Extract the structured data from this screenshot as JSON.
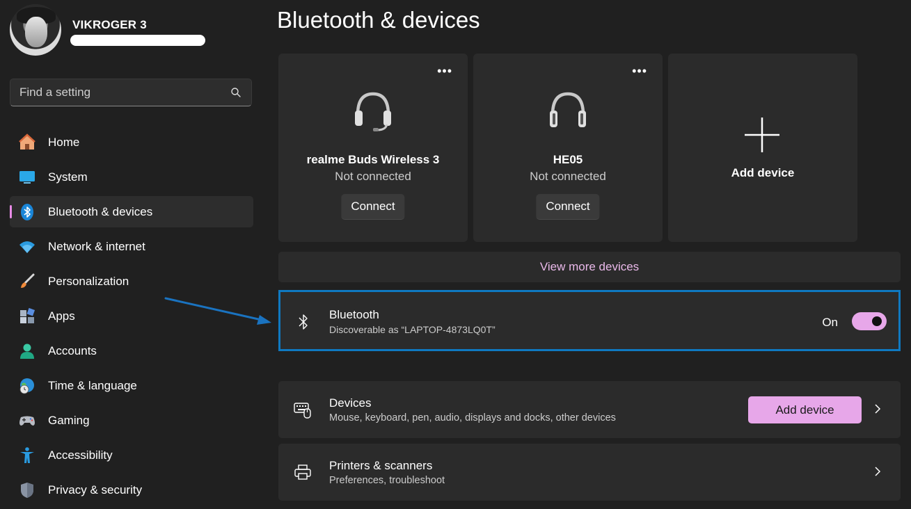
{
  "profile": {
    "username": "VIKROGER 3"
  },
  "search": {
    "placeholder": "Find a setting"
  },
  "nav": {
    "home": "Home",
    "system": "System",
    "bluetooth": "Bluetooth & devices",
    "network": "Network & internet",
    "personalization": "Personalization",
    "apps": "Apps",
    "accounts": "Accounts",
    "time": "Time & language",
    "gaming": "Gaming",
    "accessibility": "Accessibility",
    "privacy": "Privacy & security"
  },
  "page": {
    "title": "Bluetooth & devices"
  },
  "devices": [
    {
      "name": "realme Buds Wireless 3",
      "status": "Not connected",
      "connect_label": "Connect",
      "icon": "headset-icon"
    },
    {
      "name": "HE05",
      "status": "Not connected",
      "connect_label": "Connect",
      "icon": "headphones-icon"
    }
  ],
  "add_card": {
    "label": "Add device"
  },
  "more_label": "View more devices",
  "more_icon": "more-dots-icon",
  "bluetooth": {
    "title": "Bluetooth",
    "subtitle": "Discoverable as “LAPTOP-4873LQ0T”",
    "state_label": "On",
    "enabled": true
  },
  "devices_row": {
    "title": "Devices",
    "subtitle": "Mouse, keyboard, pen, audio, displays and docks, other devices",
    "button_label": "Add device"
  },
  "printers_row": {
    "title": "Printers & scanners",
    "subtitle": "Preferences, troubleshoot"
  },
  "colors": {
    "accent": "#e7a7e9",
    "highlight_border": "#0f79c1",
    "background": "#202020",
    "card": "#2b2b2b"
  }
}
